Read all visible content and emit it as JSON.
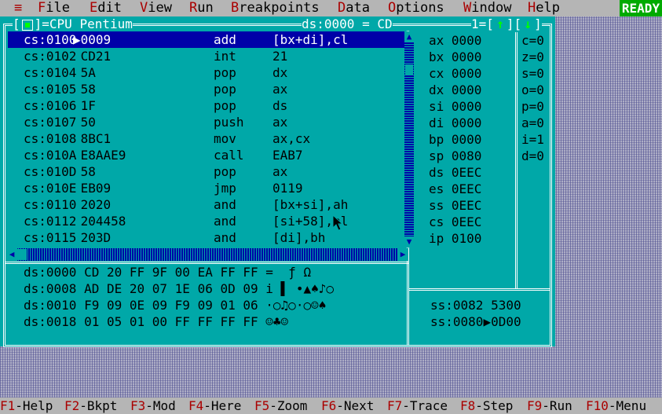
{
  "menu": {
    "system": "≡",
    "items": [
      {
        "hotkey": "F",
        "rest": "ile"
      },
      {
        "hotkey": "E",
        "rest": "dit"
      },
      {
        "hotkey": "V",
        "rest": "iew"
      },
      {
        "hotkey": "R",
        "rest": "un"
      },
      {
        "hotkey": "B",
        "rest": "reakpoints"
      },
      {
        "hotkey": "D",
        "rest": "ata"
      },
      {
        "hotkey": "O",
        "rest": "ptions"
      },
      {
        "hotkey": "W",
        "rest": "indow"
      },
      {
        "hotkey": "H",
        "rest": "elp"
      }
    ],
    "status": "READY"
  },
  "window": {
    "title": "CPU Pentium",
    "ds_title": "ds:0000 = CD",
    "number": "1=",
    "up_arrow": "↑",
    "down_arrow": "↓"
  },
  "code": [
    {
      "addr": "cs:0100",
      "bytes": "▶0009",
      "mn": "add",
      "op": "[bx+di],cl",
      "selected": true
    },
    {
      "addr": "cs:0102",
      "bytes": " CD21",
      "mn": "int",
      "op": "21"
    },
    {
      "addr": "cs:0104",
      "bytes": " 5A",
      "mn": "pop",
      "op": "dx"
    },
    {
      "addr": "cs:0105",
      "bytes": " 58",
      "mn": "pop",
      "op": "ax"
    },
    {
      "addr": "cs:0106",
      "bytes": " 1F",
      "mn": "pop",
      "op": "ds"
    },
    {
      "addr": "cs:0107",
      "bytes": " 50",
      "mn": "push",
      "op": "ax"
    },
    {
      "addr": "cs:0108",
      "bytes": " 8BC1",
      "mn": "mov",
      "op": "ax,cx"
    },
    {
      "addr": "cs:010A",
      "bytes": " E8AAE9",
      "mn": "call",
      "op": "EAB7"
    },
    {
      "addr": "cs:010D",
      "bytes": " 58",
      "mn": "pop",
      "op": "ax"
    },
    {
      "addr": "cs:010E",
      "bytes": " EB09",
      "mn": "jmp",
      "op": "0119"
    },
    {
      "addr": "cs:0110",
      "bytes": " 2020",
      "mn": "and",
      "op": "[bx+si],ah"
    },
    {
      "addr": "cs:0112",
      "bytes": " 204458",
      "mn": "and",
      "op": "[si+58],al"
    },
    {
      "addr": "cs:0115",
      "bytes": " 203D",
      "mn": "and",
      "op": "[di],bh"
    }
  ],
  "dump": [
    {
      "addr": "ds:0000",
      "bytes": "CD 20 FF 9F 00 EA FF FF",
      "ascii": "=  ƒ Ω"
    },
    {
      "addr": "ds:0008",
      "bytes": "AD DE 20 07 1E 06 0D 09",
      "ascii": "i ▌ •▲♠♪○"
    },
    {
      "addr": "ds:0010",
      "bytes": "F9 09 0E 09 F9 09 01 06",
      "ascii": "·○♫○·○☺♠"
    },
    {
      "addr": "ds:0018",
      "bytes": "01 05 01 00 FF FF FF FF",
      "ascii": "☺♣☺"
    }
  ],
  "registers": [
    {
      "name": "ax",
      "value": "0000"
    },
    {
      "name": "bx",
      "value": "0000"
    },
    {
      "name": "cx",
      "value": "0000"
    },
    {
      "name": "dx",
      "value": "0000"
    },
    {
      "name": "si",
      "value": "0000"
    },
    {
      "name": "di",
      "value": "0000"
    },
    {
      "name": "bp",
      "value": "0000"
    },
    {
      "name": "sp",
      "value": "0080"
    },
    {
      "name": "ds",
      "value": "0EEC"
    },
    {
      "name": "es",
      "value": "0EEC"
    },
    {
      "name": "ss",
      "value": "0EEC"
    },
    {
      "name": "cs",
      "value": "0EEC"
    },
    {
      "name": "ip",
      "value": "0100"
    }
  ],
  "flags": [
    "c=0",
    "z=0",
    "s=0",
    "o=0",
    "p=0",
    "a=0",
    "i=1",
    "d=0"
  ],
  "stack": [
    {
      "addr": "ss:0082",
      "marker": " ",
      "value": "5300"
    },
    {
      "addr": "ss:0080",
      "marker": "▶",
      "value": "0D00"
    }
  ],
  "statusbar": [
    {
      "key": "F1",
      "label": "-Help"
    },
    {
      "key": "F2",
      "label": "-Bkpt"
    },
    {
      "key": "F3",
      "label": "-Mod"
    },
    {
      "key": "F4",
      "label": "-Here"
    },
    {
      "key": "F5",
      "label": "-Zoom"
    },
    {
      "key": "F6",
      "label": "-Next"
    },
    {
      "key": "F7",
      "label": "-Trace"
    },
    {
      "key": "F8",
      "label": "-Step"
    },
    {
      "key": "F9",
      "label": "-Run"
    },
    {
      "key": "F10",
      "label": "-Menu"
    }
  ]
}
